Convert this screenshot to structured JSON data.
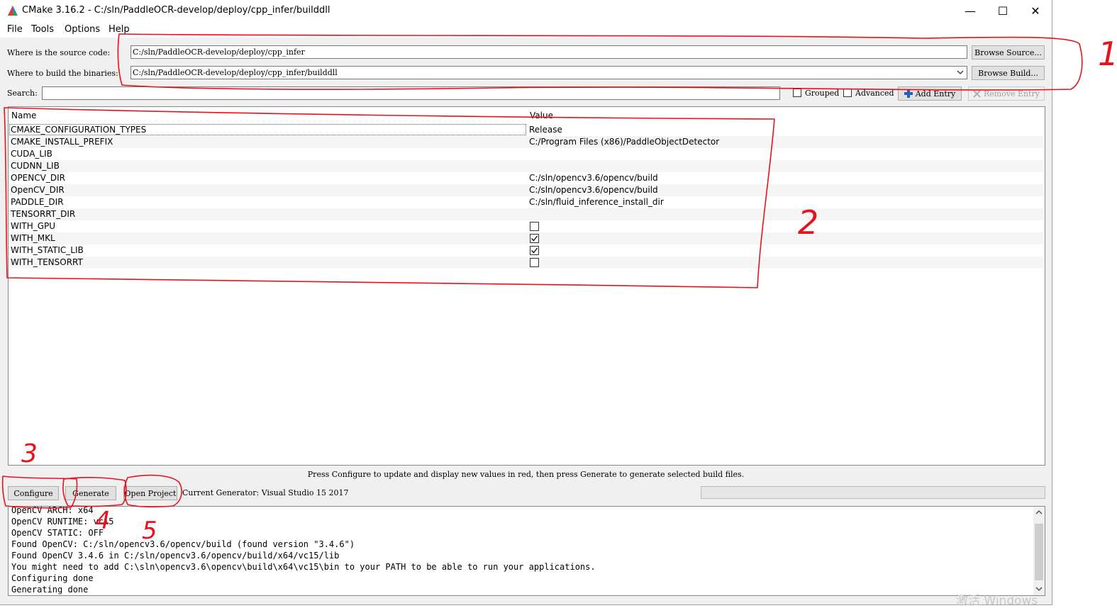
{
  "window": {
    "title": "CMake 3.16.2 - C:/sln/PaddleOCR-develop/deploy/cpp_infer/builddll",
    "minimize_glyph": "—",
    "maximize_glyph": "☐",
    "close_glyph": "✕"
  },
  "menu": [
    "File",
    "Tools",
    "Options",
    "Help"
  ],
  "source": {
    "label": "Where is the source code:",
    "value": "C:/sln/PaddleOCR-develop/deploy/cpp_infer",
    "browse": "Browse Source..."
  },
  "build": {
    "label": "Where to build the binaries:",
    "value": "C:/sln/PaddleOCR-develop/deploy/cpp_infer/builddll",
    "browse": "Browse Build..."
  },
  "search": {
    "label": "Search:",
    "value": "",
    "grouped_label": "Grouped",
    "grouped_checked": false,
    "advanced_label": "Advanced",
    "advanced_checked": false,
    "add_entry": "Add Entry",
    "remove_entry": "Remove Entry"
  },
  "table": {
    "headers": [
      "Name",
      "Value"
    ],
    "rows": [
      {
        "name": "CMAKE_CONFIGURATION_TYPES",
        "value": "Release",
        "type": "text"
      },
      {
        "name": "CMAKE_INSTALL_PREFIX",
        "value": "C:/Program Files (x86)/PaddleObjectDetector",
        "type": "text"
      },
      {
        "name": "CUDA_LIB",
        "value": "",
        "type": "text"
      },
      {
        "name": "CUDNN_LIB",
        "value": "",
        "type": "text"
      },
      {
        "name": "OPENCV_DIR",
        "value": "C:/sln/opencv3.6/opencv/build",
        "type": "text"
      },
      {
        "name": "OpenCV_DIR",
        "value": "C:/sln/opencv3.6/opencv/build",
        "type": "text"
      },
      {
        "name": "PADDLE_DIR",
        "value": "C:/sln/fluid_inference_install_dir",
        "type": "text"
      },
      {
        "name": "TENSORRT_DIR",
        "value": "",
        "type": "text"
      },
      {
        "name": "WITH_GPU",
        "checked": false,
        "type": "bool"
      },
      {
        "name": "WITH_MKL",
        "checked": true,
        "type": "bool"
      },
      {
        "name": "WITH_STATIC_LIB",
        "checked": true,
        "type": "bool"
      },
      {
        "name": "WITH_TENSORRT",
        "checked": false,
        "type": "bool"
      }
    ]
  },
  "info_text": "Press Configure to update and display new values in red, then press Generate to generate selected build files.",
  "buttons": {
    "configure": "Configure",
    "generate": "Generate",
    "open_project": "Open Project"
  },
  "generator": "Current Generator: Visual Studio 15 2017",
  "output": [
    "OpenCV ARCH: x64",
    "OpenCV RUNTIME: vc15",
    "OpenCV STATIC: OFF",
    "Found OpenCV: C:/sln/opencv3.6/opencv/build (found version \"3.4.6\")",
    "Found OpenCV 3.4.6 in C:/sln/opencv3.6/opencv/build/x64/vc15/lib",
    "You might need to add C:\\sln\\opencv3.6\\opencv\\build\\x64\\vc15\\bin to your PATH to be able to run your applications.",
    "Configuring done",
    "Generating done"
  ],
  "annotations": [
    "1",
    "2",
    "3",
    "4",
    "5"
  ],
  "watermark": "激活 Windows",
  "colors": {
    "annotation_red": "#e8121c",
    "add_icon_blue": "#1f5fbf"
  }
}
